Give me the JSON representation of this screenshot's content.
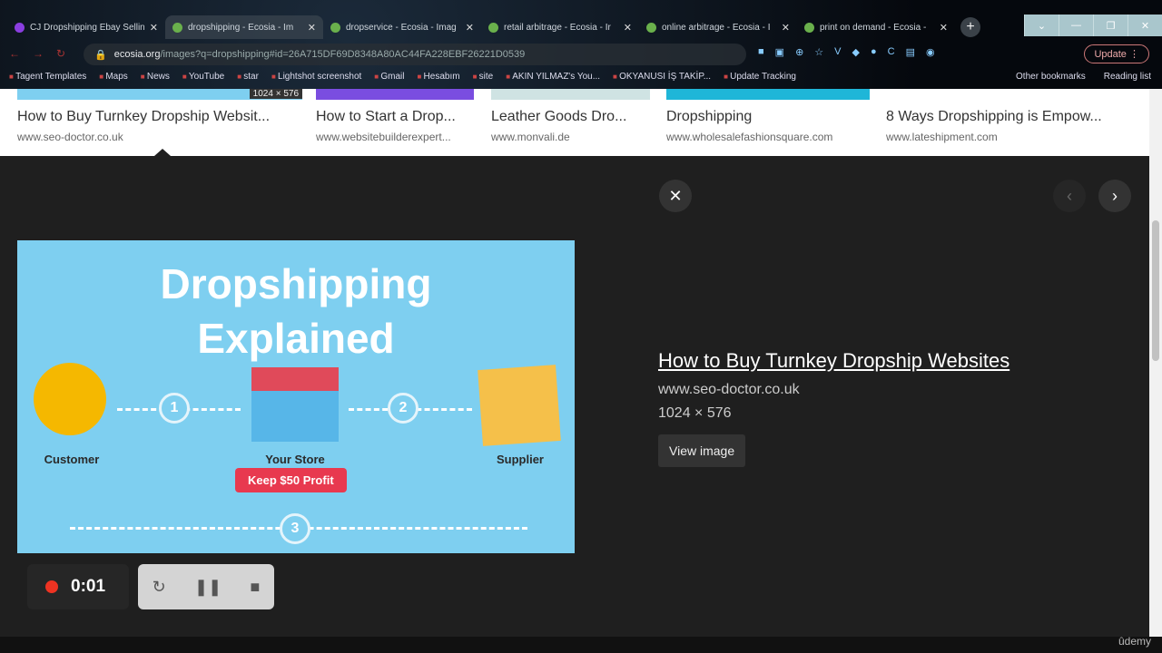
{
  "tabs": [
    {
      "title": "CJ Dropshipping Ebay Sellin",
      "active": false
    },
    {
      "title": "dropshipping - Ecosia - Im",
      "active": true
    },
    {
      "title": "dropservice - Ecosia - Imag",
      "active": false
    },
    {
      "title": "retail arbitrage - Ecosia - Ir",
      "active": false
    },
    {
      "title": "online arbitrage - Ecosia - I",
      "active": false
    },
    {
      "title": "print on demand - Ecosia -",
      "active": false
    }
  ],
  "address": {
    "domain": "ecosia.org",
    "path": "/images?q=dropshipping#id=26A715DF69D8348A80AC44FA228EBF26221D0539"
  },
  "update_label": "Update",
  "bookmarks": [
    "Tagent Templates",
    "Maps",
    "News",
    "YouTube",
    "star",
    "Lightshot screenshot",
    "Gmail",
    "Hesabım",
    "site",
    "AKIN YILMAZ's You...",
    "OKYANUSI İŞ TAKİP...",
    "Update Tracking"
  ],
  "bookmarks_right": [
    "Other bookmarks",
    "Reading list"
  ],
  "results": [
    {
      "title": "How to Buy Turnkey Dropship Websit...",
      "url": "www.seo-doctor.co.uk",
      "badge": "1024 × 576",
      "color": "#7ecff0"
    },
    {
      "title": "How to Start a Drop...",
      "url": "www.websitebuilderexpert...",
      "color": "#7a4de0"
    },
    {
      "title": "Leather Goods Dro...",
      "url": "www.monvali.de",
      "color": "#cfe3e3"
    },
    {
      "title": "Dropshipping",
      "url": "www.wholesalefashionsquare.com",
      "color": "#1fb6d8"
    },
    {
      "title": "8 Ways Dropshipping is Empow...",
      "url": "www.lateshipment.com",
      "color": "#ffffff"
    }
  ],
  "preview": {
    "heading": "Dropshipping Explained",
    "customer": "Customer",
    "store": "Your Store",
    "supplier": "Supplier",
    "profit": "Keep $50 Profit",
    "steps": [
      "1",
      "2",
      "3"
    ]
  },
  "detail": {
    "title": "How to Buy Turnkey Dropship Websites",
    "source": "www.seo-doctor.co.uk",
    "dimensions": "1024 × 576",
    "view_button": "View image"
  },
  "recorder": {
    "time": "0:01"
  },
  "watermark": "ûdemy"
}
